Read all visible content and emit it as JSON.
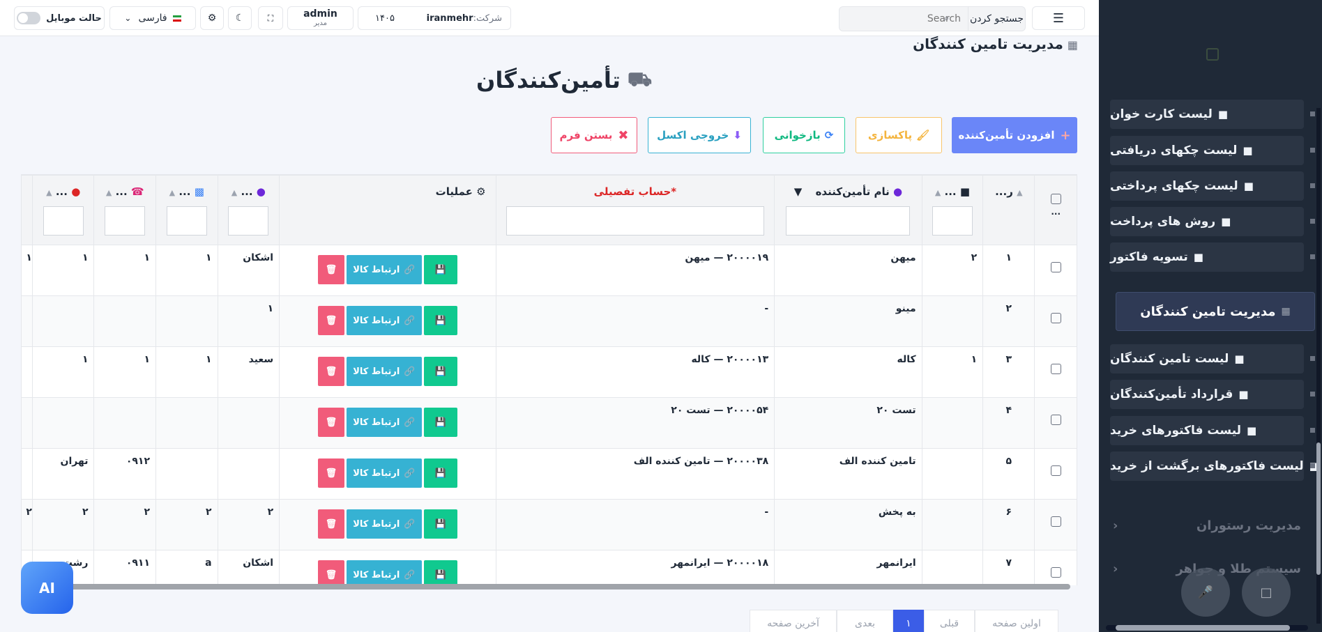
{
  "topbar": {
    "menu_icon": "hamburger-icon",
    "search_label": "جستجو کردن",
    "search_placeholder": "Search",
    "company_prefix": "شرکت:",
    "company_name": "iranmehr",
    "year": "۱۴۰۵",
    "user_name": "admin",
    "user_role": "مدیر",
    "language": "فارسی",
    "mobile_mode_label": "حالت موبایل"
  },
  "page": {
    "heading": "مدیریت تامین کنندگان",
    "title": "تأمین‌کنندگان"
  },
  "actions": {
    "add": "افزودن تأمین‌کننده",
    "clear": "پاکسازی",
    "reload": "بازخوانی",
    "excel": "خروجی اکسل",
    "close": "بستن فرم"
  },
  "table": {
    "headers": {
      "select": "...",
      "row": "ر...",
      "code": "...",
      "name": "نام تأمین‌کننده",
      "account": "*حساب تفصیلی",
      "ops": "عملیات",
      "contact": "...",
      "card": "...",
      "phone": "...",
      "location": "..."
    },
    "link_button": "ارتباط کالا",
    "rows": [
      {
        "row": "۱",
        "code": "۲",
        "name": "میهن",
        "account": "۲۰۰۰۰۱۹ — میهن",
        "contact": "اشکان",
        "card": "۱",
        "phone": "۱",
        "location": "۱",
        "extra": "۱"
      },
      {
        "row": "۲",
        "code": "",
        "name": "مینو",
        "account": "-",
        "contact": "۱",
        "card": "",
        "phone": "",
        "location": "",
        "extra": ""
      },
      {
        "row": "۳",
        "code": "۱",
        "name": "کاله",
        "account": "۲۰۰۰۰۱۳ — کاله",
        "contact": "سعید",
        "card": "۱",
        "phone": "۱",
        "location": "۱",
        "extra": ""
      },
      {
        "row": "۴",
        "code": "",
        "name": "تست ۲۰",
        "account": "۲۰۰۰۰۵۴ — تست ۲۰",
        "contact": "",
        "card": "",
        "phone": "",
        "location": "",
        "extra": ""
      },
      {
        "row": "۵",
        "code": "",
        "name": "تامین کننده الف",
        "account": "۲۰۰۰۰۳۸ — تامین کننده الف",
        "contact": "",
        "card": "",
        "phone": "۰۹۱۲",
        "location": "تهران",
        "extra": ""
      },
      {
        "row": "۶",
        "code": "",
        "name": "به پخش",
        "account": "-",
        "contact": "۲",
        "card": "۲",
        "phone": "۲",
        "location": "۲",
        "extra": "۲"
      },
      {
        "row": "۷",
        "code": "",
        "name": "ایرانمهر",
        "account": "۲۰۰۰۰۱۸ — ایرانمهر",
        "contact": "اشکان",
        "card": "a",
        "phone": "۰۹۱۱",
        "location": "رشت",
        "extra": ""
      }
    ]
  },
  "pagination": {
    "first": "اولین صفحه",
    "prev": "قبلی",
    "current": "۱",
    "next": "بعدی",
    "last": "آخرین صفحه"
  },
  "sidebar": {
    "items": [
      {
        "label": "لیست کارت خوان",
        "icon": "card-reader-icon"
      },
      {
        "label": "لیست چکهای دریافتی",
        "icon": "receipt-icon"
      },
      {
        "label": "لیست چکهای پرداختی",
        "icon": "receipt-icon"
      },
      {
        "label": "روش های پرداخت",
        "icon": "credit-card-icon"
      },
      {
        "label": "تسویه فاکتور",
        "icon": "check-icon"
      }
    ],
    "active": "مدیریت تامین کنندگان",
    "sub_items": [
      {
        "label": "لیست تامین کنندگان",
        "icon": "handshake-icon"
      },
      {
        "label": "قرارداد تأمین‌کنندگان",
        "icon": "document-icon"
      },
      {
        "label": "لیست فاکتورهای خرید",
        "icon": "clipboard-icon"
      },
      {
        "label": "لیست فاکتورهای برگشت از خرید",
        "icon": "return-icon"
      }
    ],
    "groups": [
      "مدیریت رستوران",
      "سیستم طلا و جواهر"
    ]
  },
  "ai_label": "AI",
  "colors": {
    "primary": "#5b7cf7",
    "sidebar_bg": "#1f2937",
    "save": "#10c98f",
    "link": "#36b2d3",
    "delete": "#f15b7a"
  }
}
